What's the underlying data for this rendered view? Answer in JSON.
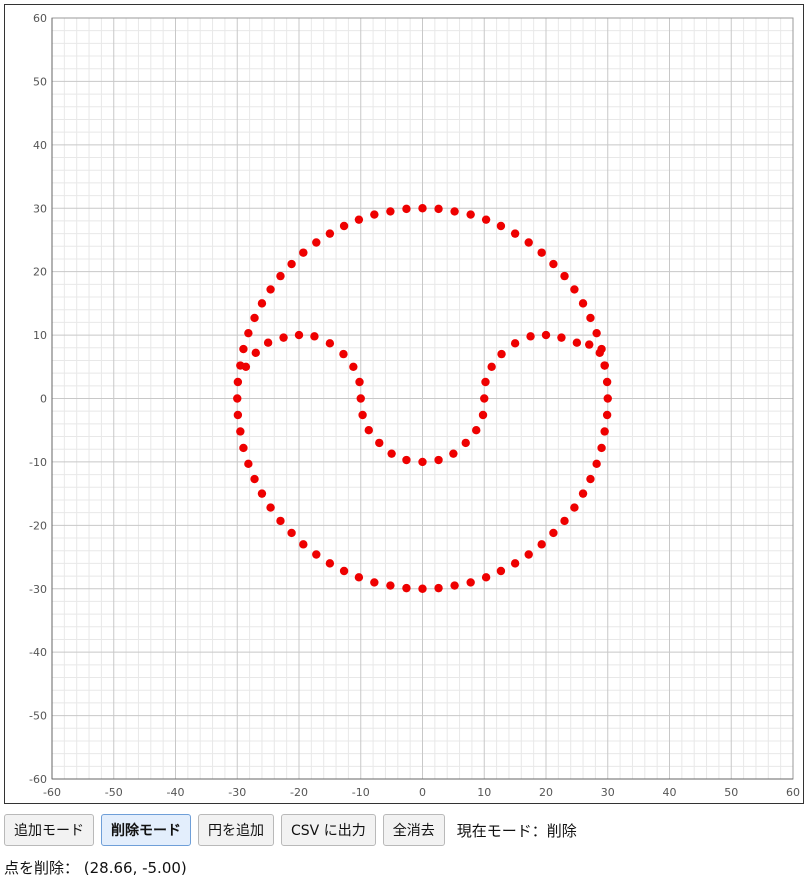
{
  "plot": {
    "x_range": [
      -60,
      60
    ],
    "y_range": [
      -60,
      60
    ],
    "major_step": 10,
    "minor_step": 2,
    "point_color": "#ee0000",
    "grid_major_color": "#c8c8c8",
    "grid_minor_color": "#e8e8e8",
    "points": [
      [
        0,
        30
      ],
      [
        2.6,
        29.9
      ],
      [
        5.2,
        29.5
      ],
      [
        7.8,
        29
      ],
      [
        10.3,
        28.2
      ],
      [
        12.7,
        27.2
      ],
      [
        15,
        26
      ],
      [
        17.2,
        24.6
      ],
      [
        19.3,
        23
      ],
      [
        21.2,
        21.2
      ],
      [
        23,
        19.3
      ],
      [
        24.6,
        17.2
      ],
      [
        26,
        15
      ],
      [
        27.2,
        12.7
      ],
      [
        28.2,
        10.3
      ],
      [
        29,
        7.8
      ],
      [
        29.5,
        5.2
      ],
      [
        29.9,
        2.6
      ],
      [
        30,
        0
      ],
      [
        29.9,
        -2.6
      ],
      [
        29.5,
        -5.2
      ],
      [
        29,
        -7.8
      ],
      [
        28.2,
        -10.3
      ],
      [
        27.2,
        -12.7
      ],
      [
        26,
        -15
      ],
      [
        24.6,
        -17.2
      ],
      [
        23,
        -19.3
      ],
      [
        21.2,
        -21.2
      ],
      [
        19.3,
        -23
      ],
      [
        17.2,
        -24.6
      ],
      [
        15,
        -26
      ],
      [
        12.7,
        -27.2
      ],
      [
        10.3,
        -28.2
      ],
      [
        7.8,
        -29
      ],
      [
        5.2,
        -29.5
      ],
      [
        2.6,
        -29.9
      ],
      [
        0,
        -30
      ],
      [
        -2.6,
        -29.9
      ],
      [
        -5.2,
        -29.5
      ],
      [
        -7.8,
        -29
      ],
      [
        -10.3,
        -28.2
      ],
      [
        -12.7,
        -27.2
      ],
      [
        -15,
        -26
      ],
      [
        -17.2,
        -24.6
      ],
      [
        -19.3,
        -23
      ],
      [
        -21.2,
        -21.2
      ],
      [
        -23,
        -19.3
      ],
      [
        -24.6,
        -17.2
      ],
      [
        -26,
        -15
      ],
      [
        -27.2,
        -12.7
      ],
      [
        -28.2,
        -10.3
      ],
      [
        -29,
        -7.8
      ],
      [
        -29.5,
        -5.2
      ],
      [
        -29.9,
        -2.6
      ],
      [
        -30,
        0
      ],
      [
        -29.9,
        2.6
      ],
      [
        -29.5,
        5.2
      ],
      [
        -29,
        7.8
      ],
      [
        -28.2,
        10.3
      ],
      [
        -27.2,
        12.7
      ],
      [
        -26,
        15
      ],
      [
        -24.6,
        17.2
      ],
      [
        -23,
        19.3
      ],
      [
        -21.2,
        21.2
      ],
      [
        -19.3,
        23
      ],
      [
        -17.2,
        24.6
      ],
      [
        -15,
        26
      ],
      [
        -12.7,
        27.2
      ],
      [
        -10.3,
        28.2
      ],
      [
        -7.8,
        29
      ],
      [
        -5.2,
        29.5
      ],
      [
        -2.6,
        29.9
      ],
      [
        29.5,
        5.2
      ],
      [
        28.7,
        7.2
      ],
      [
        27,
        8.5
      ],
      [
        25,
        8.8
      ],
      [
        22.5,
        9.6
      ],
      [
        20,
        10
      ],
      [
        17.5,
        9.8
      ],
      [
        15,
        8.7
      ],
      [
        12.8,
        7
      ],
      [
        11.2,
        5
      ],
      [
        10.2,
        2.6
      ],
      [
        10,
        0
      ],
      [
        9.8,
        -2.6
      ],
      [
        8.7,
        -5
      ],
      [
        7,
        -7
      ],
      [
        5,
        -8.7
      ],
      [
        2.6,
        -9.7
      ],
      [
        0,
        -10
      ],
      [
        -2.6,
        -9.7
      ],
      [
        -5,
        -8.7
      ],
      [
        -7,
        -7
      ],
      [
        -8.7,
        -5
      ],
      [
        -9.7,
        -2.6
      ],
      [
        -10,
        0
      ],
      [
        -10.2,
        2.6
      ],
      [
        -11.2,
        5
      ],
      [
        -12.8,
        7
      ],
      [
        -15,
        8.7
      ],
      [
        -17.5,
        9.8
      ],
      [
        -20,
        10
      ],
      [
        -22.5,
        9.6
      ],
      [
        -25,
        8.8
      ],
      [
        -27,
        7.2
      ],
      [
        -28.6,
        5
      ]
    ]
  },
  "buttons": [
    {
      "id": "add-mode",
      "label": "追加モード",
      "active": false
    },
    {
      "id": "delete-mode",
      "label": "削除モード",
      "active": true
    },
    {
      "id": "add-circle",
      "label": "円を追加",
      "active": false
    },
    {
      "id": "export-csv",
      "label": "CSV に出力",
      "active": false
    },
    {
      "id": "clear-all",
      "label": "全消去",
      "active": false
    }
  ],
  "status": {
    "mode_text": "現在モード：削除",
    "action_text": "点を削除： (28.66, -5.00)"
  }
}
